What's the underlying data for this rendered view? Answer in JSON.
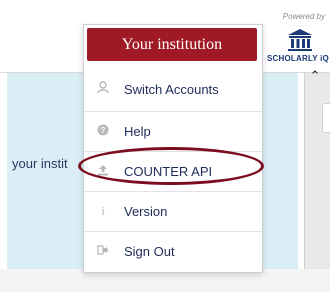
{
  "page": {
    "partial_text": "your instit"
  },
  "brand": {
    "powered_by": "Powered by",
    "name": "SCHOLARLY iQ"
  },
  "menu": {
    "header": "Your institution",
    "items": [
      {
        "label": "Switch Accounts",
        "icon": "user-icon"
      },
      {
        "label": "Help",
        "icon": "help-icon"
      },
      {
        "label": "COUNTER API",
        "icon": "upload-icon"
      },
      {
        "label": "Version",
        "icon": "info-icon"
      },
      {
        "label": "Sign Out",
        "icon": "sign-out-icon"
      }
    ],
    "highlight_color": "#7b0d1e",
    "header_color": "#a01a25"
  }
}
